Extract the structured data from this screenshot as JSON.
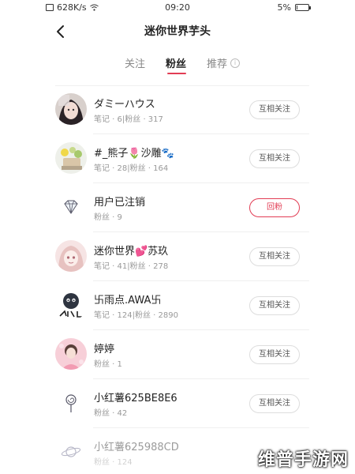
{
  "status_bar": {
    "net_speed": "628K/s",
    "time": "09:20",
    "battery": "5%",
    "battery_level": 0.05
  },
  "header": {
    "title": "迷你世界芋头"
  },
  "tabs": [
    {
      "label": "关注",
      "active": false
    },
    {
      "label": "粉丝",
      "active": true
    },
    {
      "label": "推荐",
      "active": false
    }
  ],
  "info_glyph": "i",
  "rows": [
    {
      "name": "ダミーハウス",
      "stats": "笔记 · 6|粉丝 · 317",
      "button": "互相关注",
      "avatar": "girl-portrait"
    },
    {
      "name": "#_熊子🌷沙雕🐾",
      "stats": "笔记 · 28|粉丝 · 164",
      "button": "互相关注",
      "avatar": "flower-pot"
    },
    {
      "name": "用户已注销",
      "stats": "粉丝 · 9",
      "button": "回粉",
      "avatar": "diamond"
    },
    {
      "name": "迷你世界💕苏玖",
      "stats": "笔记 · 41|粉丝 · 278",
      "button": "互相关注",
      "avatar": "anime-girl"
    },
    {
      "name": "卐雨点.AWA卐",
      "stats": "笔记 · 124|粉丝 · 2890",
      "button": "互相关注",
      "avatar": "cartoon-face"
    },
    {
      "name": "婷婷",
      "stats": "粉丝 · 1",
      "button": "互相关注",
      "avatar": "pink-girl"
    },
    {
      "name": "小红薯625BE8E6",
      "stats": "粉丝 · 42",
      "button": "互相关注",
      "avatar": "lollipop"
    },
    {
      "name": "小红薯625988CD",
      "stats": "粉丝 · 124",
      "button": "",
      "avatar": "planet"
    }
  ],
  "watermark": "维普手游网",
  "colors": {
    "accent": "#e23d54",
    "text": "#222222",
    "muted": "#999999"
  }
}
